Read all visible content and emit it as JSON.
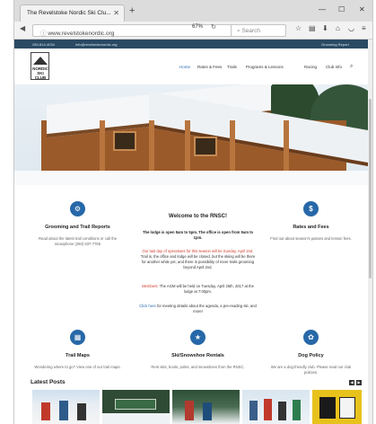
{
  "browser": {
    "tab_title": "The Revelstoke Nordic Ski Clu...",
    "url": "www.revelstokenordic.org",
    "zoom": "67%",
    "search_placeholder": "Search"
  },
  "topbar": {
    "left_items": [
      "250-814-4034",
      "info@revelstokenordic.org"
    ],
    "right_item": "Grooming Report"
  },
  "site": {
    "logo_text": "NORDIC SKI CLUB",
    "menu": [
      "Home",
      "Rates & Fees",
      "Trails",
      "Programs & Lessons",
      "Racing",
      "Club Info"
    ]
  },
  "left_column": {
    "title": "Grooming and Trail Reports",
    "text": "Read about the latest trail conditions or call the snowphone (250) 837-7765"
  },
  "center_column": {
    "title": "Welcome to the RNSC!",
    "hours": "The lodge is open 9am to 5pm. The office is open from 9am to 1pm.",
    "closing": "Our last day of operations for this season will be Sunday, April 2nd.",
    "closing_rest": "Trail is, the office and lodge will be closed, but the skiing will be there for another while yet, and there is possibility of more trails grooming beyond April 2nd.",
    "members_label": "Members:",
    "members_text": "The AGM will be held on Tuesday, April 25th, 2017 at the lodge at 7:00pm.",
    "click_here": "Click here",
    "click_rest": "for meeting details about the agenda, a pre-reading ski, and more!"
  },
  "right_column": {
    "title": "Rates and Fees",
    "text": "Find out about season's passes and lesson fees."
  },
  "bottom_row": [
    {
      "title": "Trail Maps",
      "text": "Wondering where to go? View one of our trail maps."
    },
    {
      "title": "Ski/Snowshoe Rentals",
      "text": "Rent skis, boots, poles, and snowshoes from the RNSC."
    },
    {
      "title": "Dog Policy",
      "text": "We are a dog-friendly club. Please read our club policies."
    }
  ],
  "latest_posts": {
    "heading": "Latest Posts"
  },
  "colors": {
    "accent_blue": "#2668a8",
    "alert_red": "#d23a2a",
    "topbar": "#2a4a63"
  }
}
